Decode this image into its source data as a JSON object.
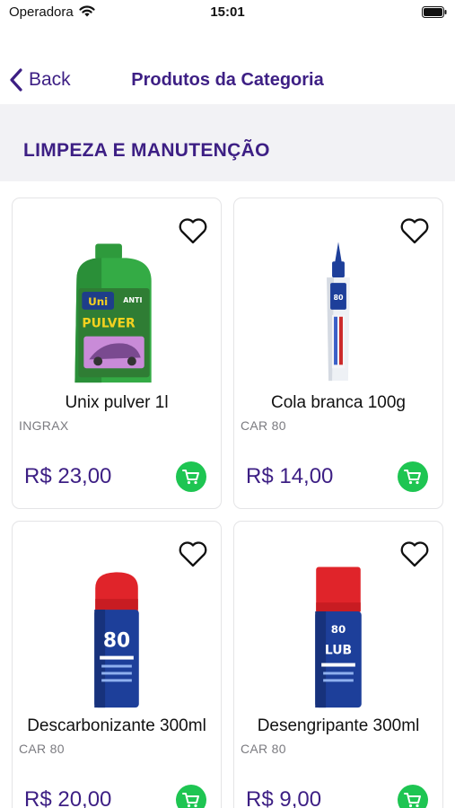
{
  "status_bar": {
    "carrier": "Operadora",
    "time": "15:01"
  },
  "nav": {
    "back_label": "Back",
    "title": "Produtos da Categoria"
  },
  "category": {
    "title": "LIMPEZA E MANUTENÇÃO"
  },
  "colors": {
    "accent": "#3d1f84",
    "cart": "#1ec552",
    "header_bg": "#f2f2f5"
  },
  "products": [
    {
      "name": "Unix pulver 1l",
      "brand": "INGRAX",
      "price": "R$ 23,00",
      "image": "green-oil-bottle"
    },
    {
      "name": "Cola branca 100g",
      "brand": "CAR 80",
      "price": "R$ 14,00",
      "image": "glue-tube"
    },
    {
      "name": "Descarbonizante 300ml",
      "brand": "CAR 80",
      "price": "R$ 20,00",
      "image": "spray-can-blue"
    },
    {
      "name": "Desengripante 300ml",
      "brand": "CAR 80",
      "price": "R$ 9,00",
      "image": "spray-can-lube"
    }
  ]
}
